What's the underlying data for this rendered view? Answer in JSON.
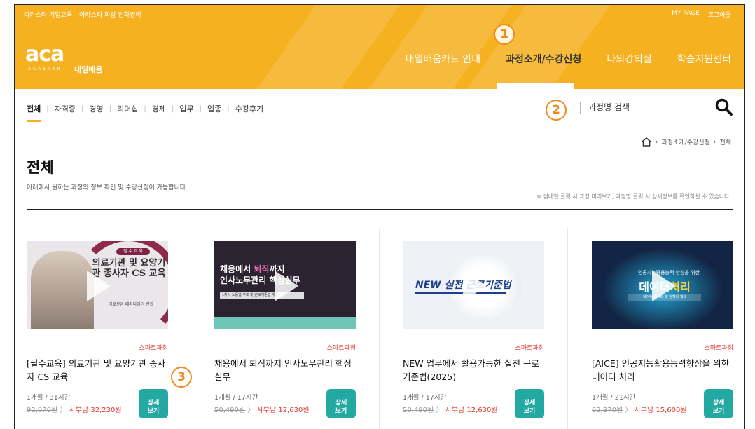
{
  "header": {
    "top_links": [
      "아카스타 기업교육",
      "아카스타 화상 전화영어"
    ],
    "top_right": [
      "MY PAGE",
      "로그아웃"
    ],
    "logo": {
      "main": "aca",
      "sub": "ACASTAR",
      "kr": "내일배움"
    },
    "nav": [
      {
        "label": "내일배움카드 안내"
      },
      {
        "label": "과정소개/수강신청"
      },
      {
        "label": "나의강의실"
      },
      {
        "label": "학습지원센터"
      }
    ],
    "active_nav": "과정소개/수강신청",
    "colors": {
      "brand": "#f5b120",
      "accent_red": "#e2382d",
      "button_teal": "#24a8a2"
    }
  },
  "categories": {
    "items": [
      "전체",
      "자격증",
      "경영",
      "리더십",
      "경제",
      "업무",
      "업종",
      "수강후기"
    ],
    "active": "전체"
  },
  "search": {
    "placeholder": "과정명 검색",
    "icon": "search-icon"
  },
  "breadcrumb": {
    "items": [
      "과정소개/수강신청",
      "전체"
    ],
    "icon": "home-icon"
  },
  "page": {
    "title": "전체",
    "description": "아래에서 원하는 과정의 정보 확인 및 수강신청이 가능합니다.",
    "note": "※ 썸네일 클릭 시 과정 미리보기, 과정명 클릭 시 상세정보를 확인하실 수 있습니다."
  },
  "courses": [
    {
      "type": "스마트과정",
      "title": "[필수교육] 의료기관 및 요양기관 종사자 CS 교육",
      "duration": "1개월 / 31시간",
      "orig_price": "92,070원",
      "self_pay": "자부담 32,230원",
      "detail_label": "상세 보기",
      "thumb": {
        "badge": "필 수 교 육",
        "headline": "의료기관 및 요양기관 종사자 CS 교육",
        "sub": "의료산업 패러다임의 변화"
      }
    },
    {
      "type": "스마트과정",
      "title": "채용에서 퇴직까지 인사노무관리 핵심실무",
      "duration": "1개월 / 17시간",
      "orig_price": "50,490원",
      "self_pay": "자부담 12,630원",
      "detail_label": "상세 보기",
      "thumb": {
        "headline_a": "채용에서 ",
        "headline_b": "퇴직",
        "headline_c": "까지",
        "headline2": "인사노무관리 핵심실무",
        "sub": "1차시 노동법 구조 및 근로기준법 개관"
      }
    },
    {
      "type": "스마트과정",
      "title": "NEW 업무에서 활용가능한 실전 근로기준법(2025)",
      "duration": "1개월 / 17시간",
      "orig_price": "50,490원",
      "self_pay": "자부담 12,630원",
      "detail_label": "상세 보기",
      "thumb": {
        "headline": "NEW 실전 근로기준법"
      }
    },
    {
      "type": "스마트과정",
      "title": "[AICE] 인공지능활용능력향상을 위한 데이터 처리",
      "duration": "1개월 / 21시간",
      "orig_price": "62,370원",
      "self_pay": "자부담 15,600원",
      "detail_label": "상세 보기",
      "thumb": {
        "top": "인공지능활용능력 향상을 위한",
        "headline_a": "데이터",
        "headline_b": "처리",
        "sub": "데이터 시각화 및 전처리 개요"
      }
    }
  ],
  "annotations": [
    "1",
    "2",
    "3"
  ]
}
